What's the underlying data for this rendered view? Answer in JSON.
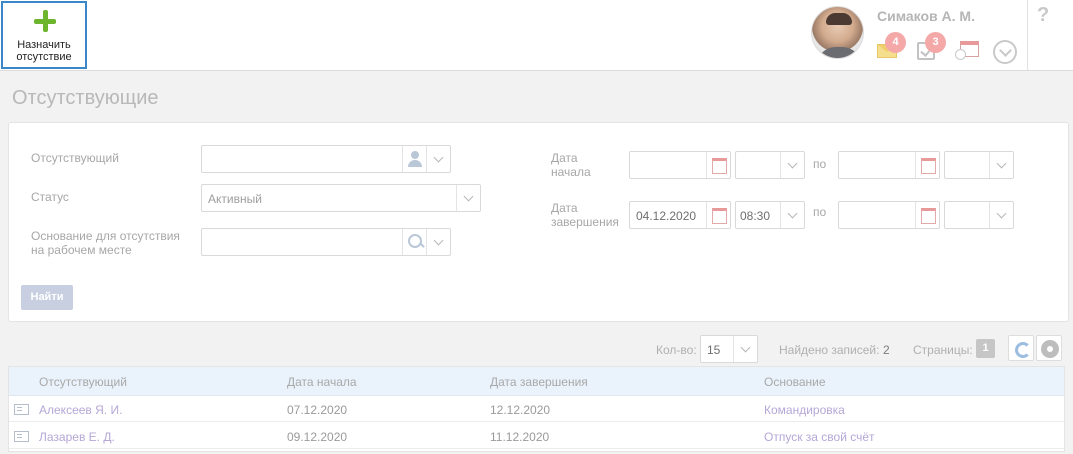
{
  "toolbar": {
    "new_absence_label": "Назначить отсутствие"
  },
  "user": {
    "name": "Симаков А. М.",
    "mail_count": "4",
    "task_count": "3"
  },
  "page": {
    "title": "Отсутствующие"
  },
  "filters": {
    "absent_label": "Отсутствующий",
    "absent_value": "",
    "status_label": "Статус",
    "status_value": "Активный",
    "reason_label": "Основание для отсутствия на рабочем месте",
    "reason_value": "",
    "start_label": "Дата начала",
    "start_date_from": "",
    "start_time_from": "",
    "start_date_to": "",
    "start_time_to": "",
    "end_label": "Дата завершения",
    "end_date_from": "04.12.2020",
    "end_time_from": "08:30",
    "end_date_to": "",
    "end_time_to": "",
    "to_label": "по",
    "find_button": "Найти"
  },
  "pager": {
    "count_label": "Кол-во:",
    "count_value": "15",
    "found_label": "Найдено записей:",
    "found_value": "2",
    "pages_label": "Страницы:",
    "page_value": "1"
  },
  "table": {
    "columns": [
      "Отсутствующий",
      "Дата начала",
      "Дата завершения",
      "Основание"
    ],
    "rows": [
      [
        "Алексеев Я. И.",
        "07.12.2020",
        "12.12.2020",
        "Командировка"
      ],
      [
        "Лазарев Е. Д.",
        "09.12.2020",
        "11.12.2020",
        "Отпуск за свой счёт"
      ]
    ]
  },
  "colors": {
    "accent_border": "#3a86c8",
    "plus_green": "#6cb52d",
    "badge": "#f4a8a8",
    "link": "#b5a7d6",
    "header_bg": "#eaf2fb"
  },
  "icons": [
    "plus-icon",
    "mail-icon",
    "task-icon",
    "calendar-icon",
    "chevron-down-icon",
    "help-icon",
    "person-icon",
    "search-icon",
    "refresh-icon",
    "gear-icon",
    "row-card-icon"
  ]
}
